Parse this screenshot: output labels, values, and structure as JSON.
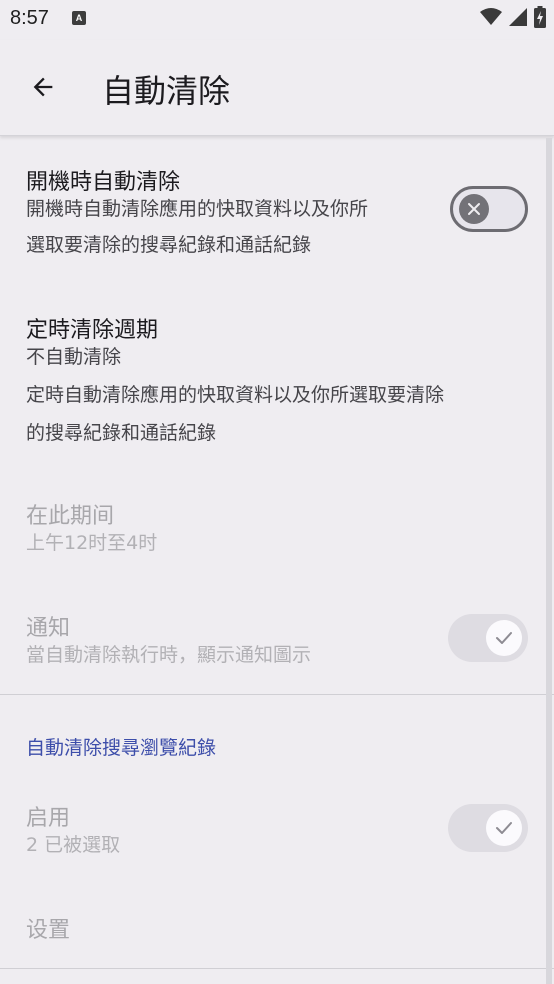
{
  "status_bar": {
    "time": "8:57",
    "notification_badge": "A"
  },
  "app_bar": {
    "title": "自動清除",
    "back_icon": "arrow-back-icon"
  },
  "settings": {
    "boot_clear": {
      "title": "開機時自動清除",
      "summary_line1": "開機時自動清除應用的快取資料以及你所",
      "summary_line2": "選取要清除的搜尋紀錄和通話紀錄",
      "toggle_state": "off"
    },
    "schedule": {
      "title": "定時清除週期",
      "value": "不自動清除",
      "summary_line1": "定時自動清除應用的快取資料以及你所選取要清除",
      "summary_line2": "的搜尋紀錄和通話紀錄"
    },
    "period": {
      "title": "在此期间",
      "value": "上午12时至4时",
      "enabled": false
    },
    "notify": {
      "title": "通知",
      "summary": "當自動清除執行時，顯示通知圖示",
      "toggle_state": "on",
      "enabled": false
    },
    "search_category": {
      "label": "自動清除搜尋瀏覽紀錄"
    },
    "enable": {
      "title": "启用",
      "summary": "2 已被選取",
      "toggle_state": "on",
      "enabled": false
    },
    "settings_item": {
      "title": "设置",
      "enabled": false
    }
  },
  "colors": {
    "background": "#efedf1",
    "accent": "#3d4eaa",
    "toggle_off_thumb": "#737278"
  }
}
